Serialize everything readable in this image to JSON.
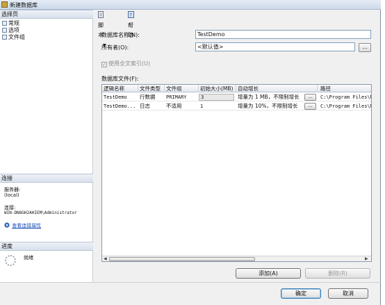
{
  "window": {
    "title": "新建数据库"
  },
  "left_pane": {
    "select_page_header": "选择页",
    "pages": [
      "常规",
      "选项",
      "文件组"
    ],
    "connection_header": "连接",
    "server_label": "服务器:",
    "server_value": "(local)",
    "connection_label": "连接:",
    "connection_value": "WIN-DN8GH2AHIEM\\Administrator",
    "view_connection_link": "查看连接属性",
    "progress_header": "进度",
    "progress_status": "就绪"
  },
  "toolbar": {
    "script_label": "脚本",
    "help_label": "帮助"
  },
  "form": {
    "db_name_label": "数据库名称(N):",
    "db_name_value": "TestDemo",
    "owner_label": "所有者(O):",
    "owner_value": "<默认值>",
    "owner_browse": "...",
    "fulltext_label": "使用全文索引(U)",
    "fulltext_checked": true,
    "files_label": "数据库文件(F):"
  },
  "files_table": {
    "headers": [
      "逻辑名称",
      "文件类型",
      "文件组",
      "初始大小(MB)",
      "自动增长",
      "路径"
    ],
    "rows": [
      [
        "TestDemo",
        "行数据",
        "PRIMARY",
        "3",
        "增量为 1 MB，不限制增长",
        "C:\\Program Files\\Mic"
      ],
      [
        "TestDemo...",
        "日志",
        "不适用",
        "1",
        "增量为 10%，不限制增长",
        "C:\\Program Files\\Mic"
      ]
    ],
    "browse_label": "..."
  },
  "buttons": {
    "add": "添加(A)",
    "remove": "删除(R)",
    "ok": "确定",
    "cancel": "取消"
  }
}
